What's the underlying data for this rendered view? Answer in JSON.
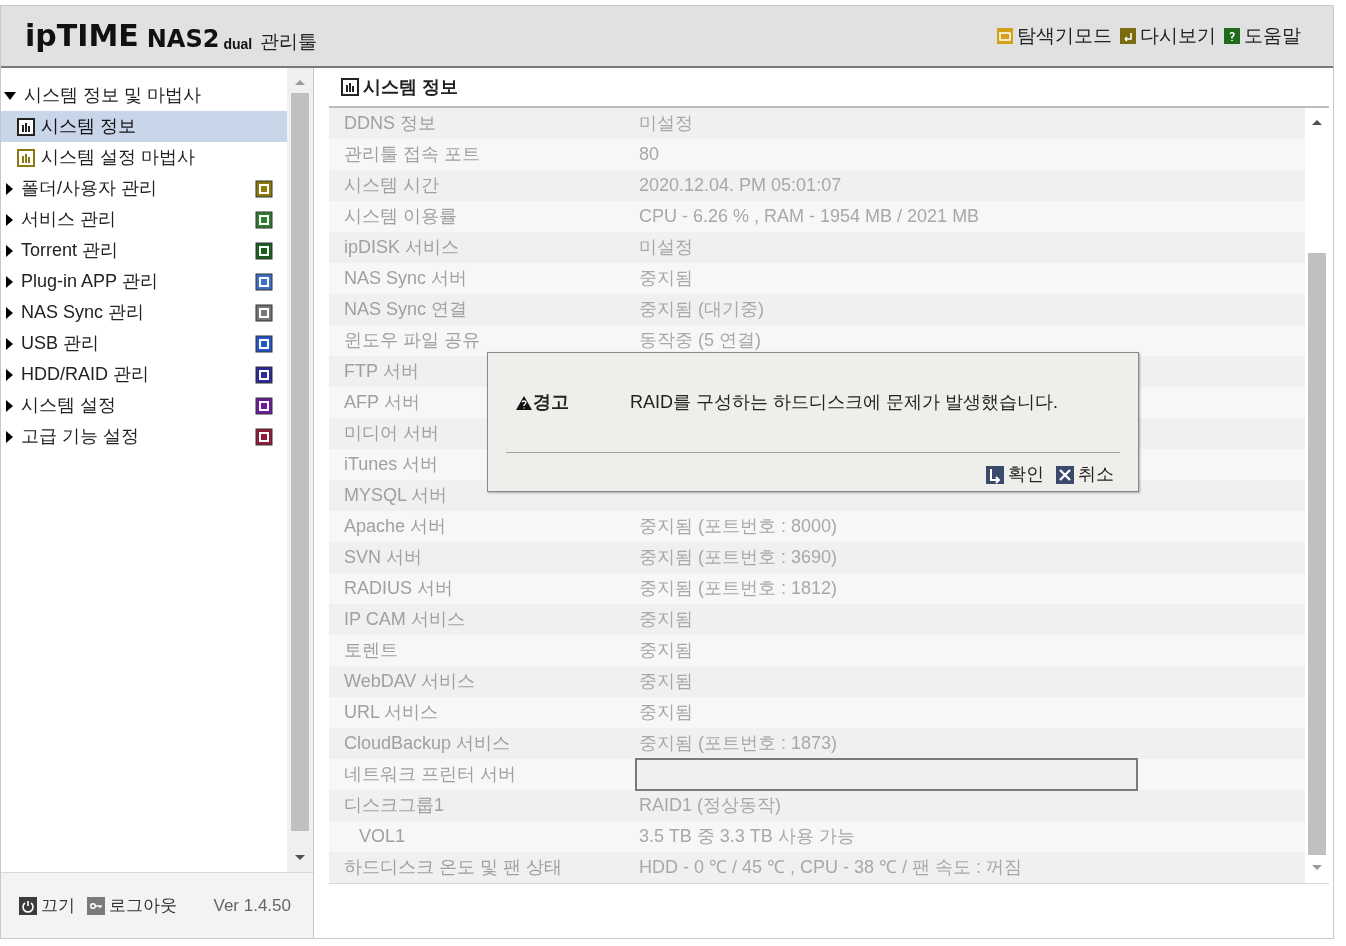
{
  "header": {
    "logo_brand": "ipTIME",
    "logo_model": "NAS2",
    "logo_suffix": "dual",
    "logo_tool": "관리툴",
    "links": [
      {
        "label": "탐색기모드",
        "kind": "folder"
      },
      {
        "label": "다시보기",
        "kind": "refresh"
      },
      {
        "label": "도움말",
        "kind": "help"
      }
    ]
  },
  "sidebar": {
    "items": [
      {
        "label": "시스템 정보 및 마법사",
        "expanded": true,
        "children": [
          {
            "label": "시스템 정보",
            "selected": true
          },
          {
            "label": "시스템 설정 마법사",
            "selected": false
          }
        ]
      },
      {
        "label": "폴더/사용자 관리",
        "expanded": false,
        "color": "#8a7a10"
      },
      {
        "label": "서비스 관리",
        "expanded": false,
        "color": "#2e7d32"
      },
      {
        "label": "Torrent 관리",
        "expanded": false,
        "color": "#1b5e20"
      },
      {
        "label": "Plug-in APP 관리",
        "expanded": false,
        "color": "#3f6fc4"
      },
      {
        "label": "NAS Sync 관리",
        "expanded": false,
        "color": "#757575"
      },
      {
        "label": "USB 관리",
        "expanded": false,
        "color": "#2456c8"
      },
      {
        "label": "HDD/RAID 관리",
        "expanded": false,
        "color": "#2a2a9a"
      },
      {
        "label": "시스템 설정",
        "expanded": false,
        "color": "#6a1b9a"
      },
      {
        "label": "고급 기능 설정",
        "expanded": false,
        "color": "#8e1b3a"
      }
    ],
    "footer": {
      "power": "끄기",
      "logout": "로그아웃",
      "version": "Ver 1.4.50"
    }
  },
  "main": {
    "title": "시스템 정보",
    "rows": [
      {
        "label": "DDNS 정보",
        "value": "미설정",
        "kind": "text"
      },
      {
        "label": "관리툴 접속 포트",
        "value": "80",
        "kind": "text"
      },
      {
        "label": "시스템 시간",
        "value": "2020.12.04. PM 05:01:07",
        "kind": "text"
      },
      {
        "label": "시스템 이용률",
        "value": "CPU - 6.26 % , RAM - 1954 MB / 2021 MB",
        "kind": "text"
      },
      {
        "label": "ipDISK 서비스",
        "value": "미설정",
        "kind": "text"
      },
      {
        "label": "NAS Sync 서버",
        "value": "중지됨",
        "kind": "text"
      },
      {
        "label": "NAS Sync 연결",
        "value": "중지됨 (대기중)",
        "kind": "text"
      },
      {
        "label": "윈도우 파일 공유",
        "value": "동작중 (5 연결)",
        "kind": "text"
      },
      {
        "label": "FTP 서버",
        "kind": "text"
      },
      {
        "label": "AFP 서버",
        "kind": "text"
      },
      {
        "label": "미디어 서버",
        "kind": "text"
      },
      {
        "label": "iTunes 서버",
        "kind": "text"
      },
      {
        "label": "MYSQL 서버",
        "kind": "text"
      },
      {
        "label": "Apache 서버",
        "value": "중지됨 (포트번호 : 8000)",
        "kind": "text"
      },
      {
        "label": "SVN 서버",
        "value": "중지됨 (포트번호 : 3690)",
        "kind": "text"
      },
      {
        "label": "RADIUS 서버",
        "value": "중지됨 (포트번호 : 1812)",
        "kind": "text"
      },
      {
        "label": "IP CAM 서비스",
        "value": "중지됨",
        "kind": "text"
      },
      {
        "label": "토렌트",
        "value": "중지됨",
        "kind": "text"
      },
      {
        "label": "WebDAV 서비스",
        "value": "중지됨",
        "kind": "text"
      },
      {
        "label": "URL 서비스",
        "value": "중지됨",
        "kind": "text"
      },
      {
        "label": "CloudBackup 서비스",
        "value": "중지됨 (포트번호 : 1873)",
        "kind": "text"
      },
      {
        "label": "네트워크 프린터 서버",
        "kind": "field"
      },
      {
        "label": "디스크그룹1",
        "value": "RAID1 (정상동작)",
        "kind": "text"
      },
      {
        "label": "VOL1",
        "value": "3.5 TB 중 3.3 TB 사용 가능",
        "kind": "sub"
      },
      {
        "label": "하드디스크 온도 및 팬 상태",
        "value": "HDD - 0 ℃ / 45 ℃ , CPU - 38 ℃ / 팬 속도 : 꺼짐",
        "kind": "text"
      }
    ]
  },
  "dialog": {
    "title": "경고",
    "message": "RAID를 구성하는 하드디스크에 문제가 발생했습니다.",
    "buttons": [
      {
        "label": "확인",
        "kind": "ok"
      },
      {
        "label": "취소",
        "kind": "cancel"
      }
    ]
  }
}
